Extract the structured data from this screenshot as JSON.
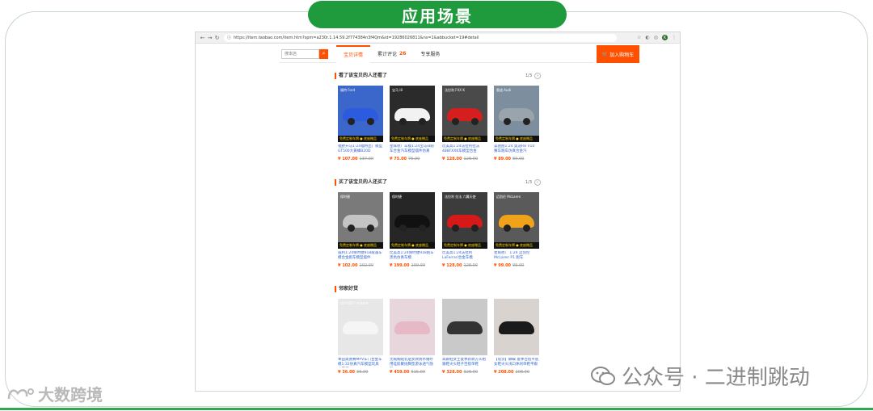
{
  "slide": {
    "title": "应用场景"
  },
  "browser": {
    "url": "https://item.taobao.com/item.htm?spm=a230r.1.14.59.2f774384n3f4Qm&id=19286026811&ns=1&abbucket=19#detail",
    "profile_initial": "K"
  },
  "shop": {
    "search_placeholder": "搜本店",
    "tabs": [
      {
        "label": "宝贝详情"
      },
      {
        "label": "累计评论",
        "count": "26"
      },
      {
        "label": "专享服务"
      }
    ],
    "cart_label": "加入购物车"
  },
  "sections": [
    {
      "title": "看了该宝贝的人还看了",
      "pager": "1/3",
      "items": [
        {
          "brand": "福特 Ford",
          "tag": "免费定制车牌 ● 底座赠品",
          "desc": "福野开马1:24福特出厂模型GT500大黄蜂B20D",
          "price": "¥ 107.00",
          "old": "137.00",
          "bg": "#3a67c9",
          "car": "#2d5be0"
        },
        {
          "brand": "宝马 i8",
          "tag": "免费定制车牌 ● 底座赠品",
          "desc": "星辉原厂车模1:24宝马i8跑车合金汽车模型摆件仿真",
          "price": "¥ 75.00",
          "old": "75.00",
          "bg": "#2b2b2b",
          "car": "#f2f2f2"
        },
        {
          "brand": "法拉利 FXX K",
          "tag": "免费定制车牌 ● 底座赠品",
          "desc": "比美高1:24法拉利拉法488FXXK车模型合金",
          "price": "¥ 128.00",
          "old": "128.00",
          "bg": "#4a4a4a",
          "car": "#d51f1f"
        },
        {
          "brand": "奥迪 Audi",
          "tag": "免费定制车牌 ● 底座赠品",
          "desc": "美驰图1:24 奥迪R8 V10 赛车跑车仿真合金汽",
          "price": "¥ 89.00",
          "old": "89.00",
          "bg": "#7d8e9e",
          "car": "#9aa4ac"
        }
      ]
    },
    {
      "title": "买了该宝贝的人还买了",
      "pager": "1/3",
      "items": [
        {
          "brand": "保时捷",
          "tag": "免费定制车牌 ● 底座赠品",
          "desc": "威利1:24保时捷918敞篷车模合金跑车模型摆件",
          "price": "¥ 102.00",
          "old": "102.00",
          "bg": "#7a7a7a",
          "car": "#c4c4c4"
        },
        {
          "brand": "保时捷",
          "tag": "免费定制车牌 ● 底座赠品",
          "desc": "比美高1:24保时捷918跑车 黑色仿真车模",
          "price": "¥ 199.00",
          "old": "199.00",
          "bg": "#262626",
          "car": "#111111"
        },
        {
          "brand": "法拉利 拉法 六翼天使",
          "tag": "免费定制车牌 ● 底座赠品",
          "desc": "比美高1:24法拉利LaFerrari合金车模",
          "price": "¥ 128.00",
          "old": "128.00",
          "bg": "#3c3c3c",
          "car": "#d61919"
        },
        {
          "brand": "迈凯伦 McLaren",
          "tag": "免费定制车牌 ● 底座赠品",
          "desc": "星辉原厂 1:24 迈凯伦McLaren P1 跑车",
          "price": "¥ 99.00",
          "old": "99.00",
          "bg": "#5a5a5a",
          "car": "#f0a31a"
        }
      ]
    },
    {
      "title": "邻家好货",
      "pager": "",
      "items": [
        {
          "brand": "ODYSSEY HONDA",
          "tag": "",
          "desc": "本田奥德赛MPV车门合金车模1:32仿真汽车模型玩具 六开门",
          "price": "¥ 36.00",
          "old": "36.00",
          "bg": "#e7e7e7",
          "car": "#f5f5f5"
        },
        {
          "brand": "",
          "tag": "",
          "desc": "无痕胸贴乳贴女款防水婚纱用硅胶聚拢胸垫游泳透气隐形",
          "price": "¥ 459.00",
          "old": "515.00",
          "bg": "#e8d6dd",
          "car": "#e7b8c5"
        },
        {
          "brand": "",
          "tag": "",
          "desc": "高跟鞋女士夏季新款方头粗跟鞋尖头鞋子百搭单鞋",
          "price": "¥ 328.00",
          "old": "328.00",
          "bg": "#c9c9c9",
          "car": "#333333"
        },
        {
          "brand": "",
          "tag": "",
          "desc": "【现货】蝴蝶 夏季百搭平底女鞋尖头浅口休闲单鞋平跟",
          "price": "¥ 208.00",
          "old": "208.00",
          "bg": "#d8d3cf",
          "car": "#1a1a1a"
        }
      ]
    }
  ],
  "watermarks": {
    "right": "公众号 · 二进制跳动",
    "left": "大数跨境"
  }
}
